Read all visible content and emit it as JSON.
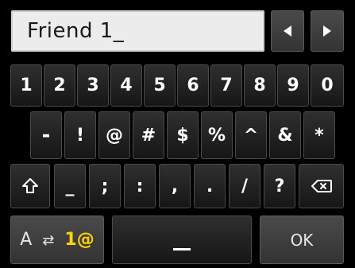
{
  "input": {
    "value": "Friend 1_"
  },
  "nav": {
    "left_arrow": "◀",
    "right_arrow": "▶"
  },
  "rows": [
    [
      "1",
      "2",
      "3",
      "4",
      "5",
      "6",
      "7",
      "8",
      "9",
      "0"
    ],
    [
      "-",
      "!",
      "@",
      "#",
      "$",
      "%",
      "^",
      "&",
      "*"
    ],
    [
      "_",
      ";",
      ":",
      ",",
      ".",
      "/",
      "?"
    ]
  ],
  "bottom": {
    "mode": {
      "alpha": "A",
      "cycle": "⇄",
      "numeric": "1@"
    },
    "ok": "OK"
  },
  "icons": {
    "shift": "shift-icon",
    "backspace": "backspace-icon",
    "space": "space-icon"
  }
}
